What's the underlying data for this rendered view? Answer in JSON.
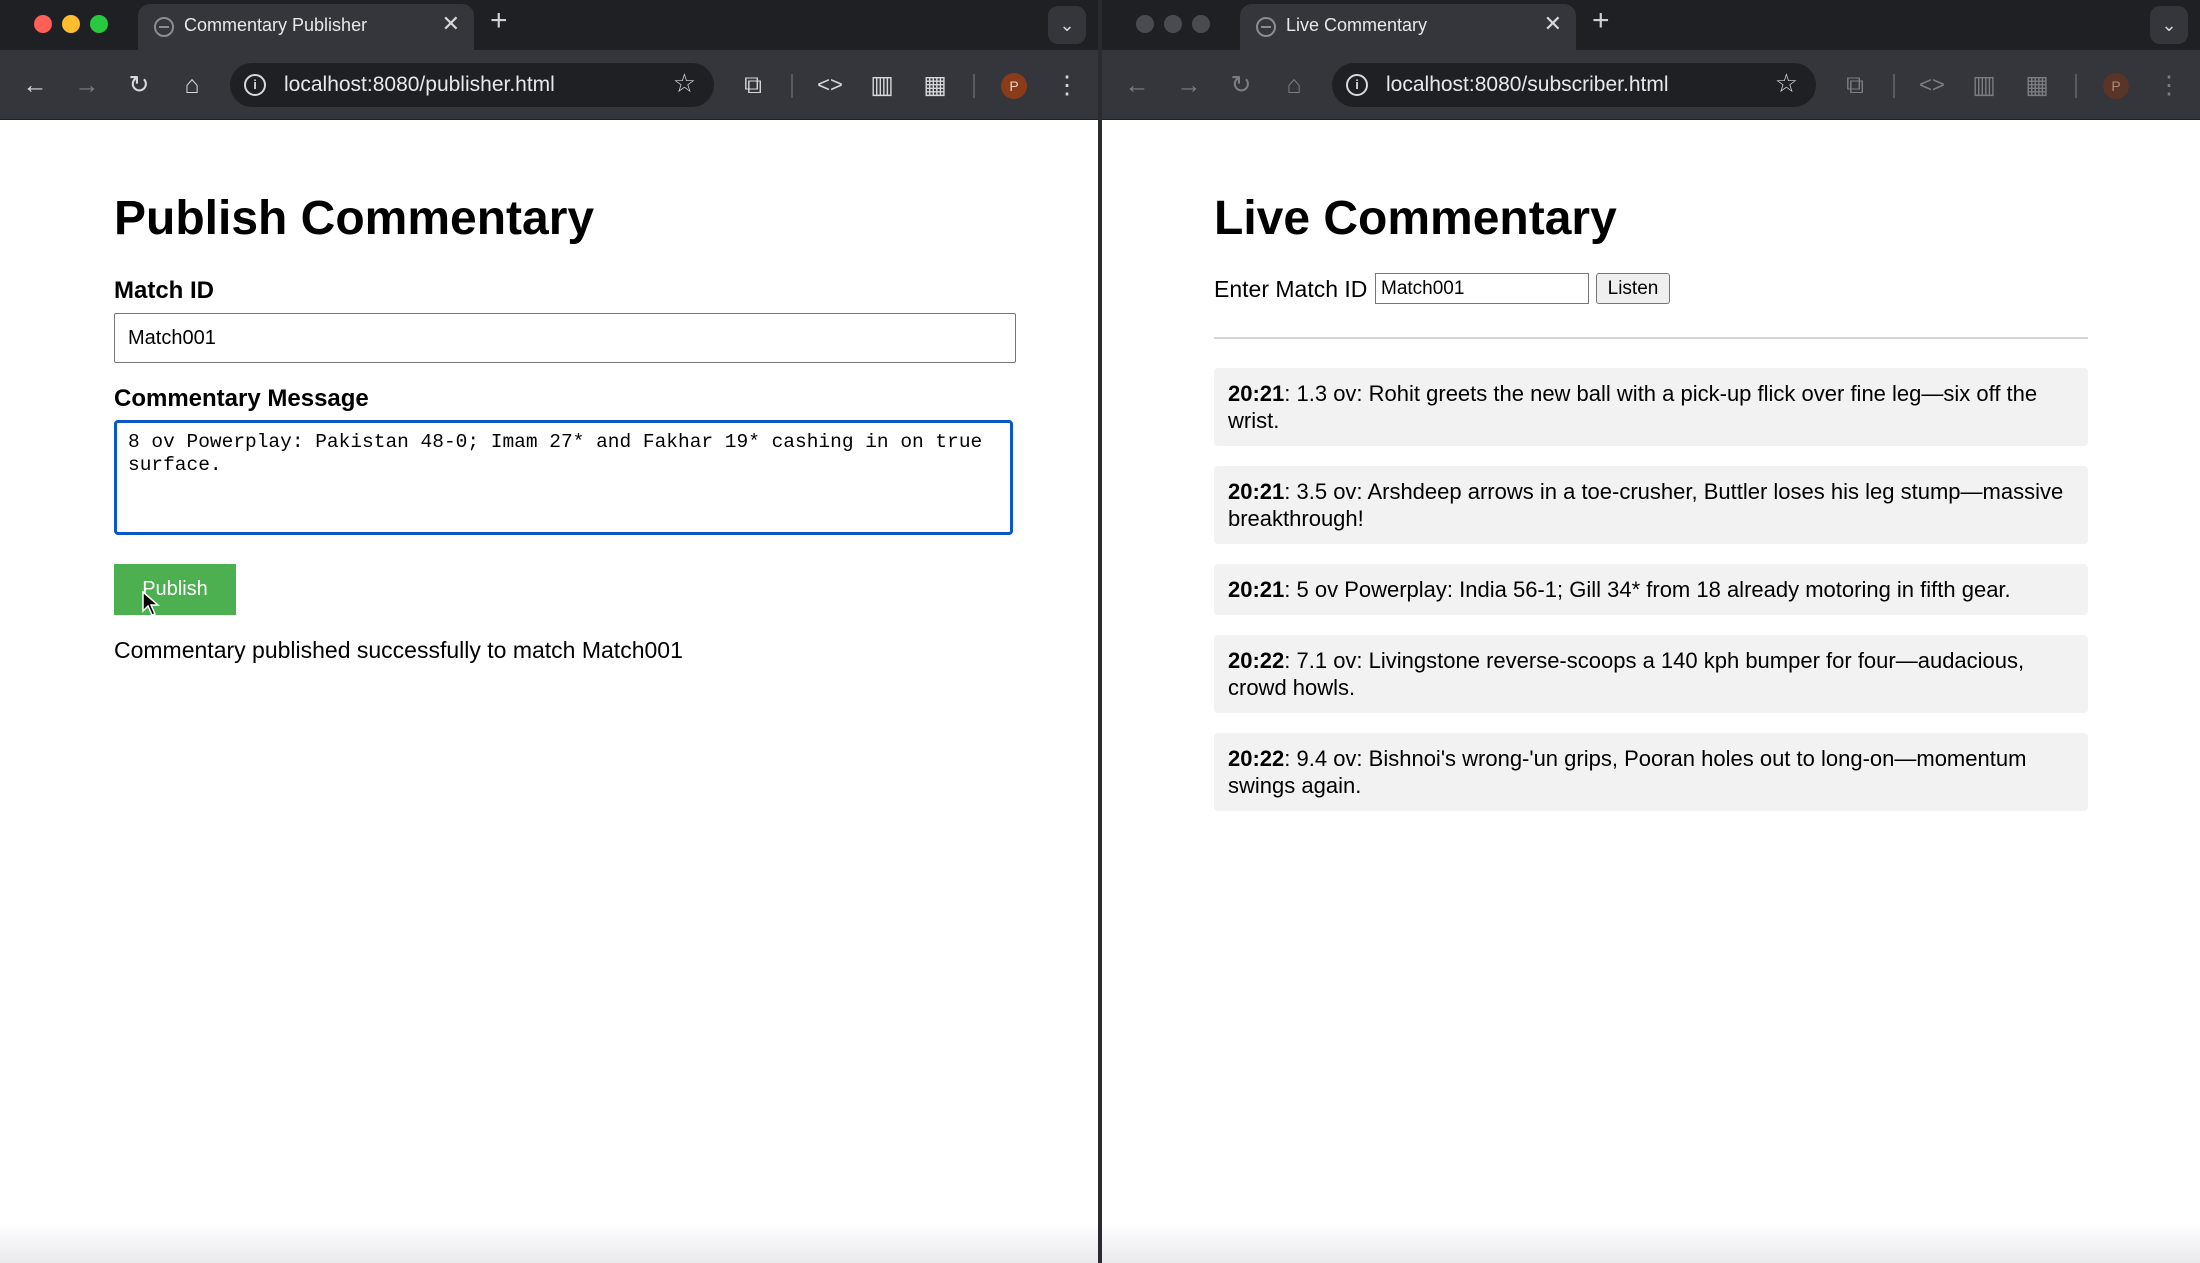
{
  "left_window": {
    "tab_title": "Commentary Publisher",
    "url": "localhost:8080/publisher.html",
    "profile_initial": "P",
    "page": {
      "heading": "Publish Commentary",
      "match_id_label": "Match ID",
      "match_id_value": "Match001",
      "message_label": "Commentary Message",
      "message_value": "8 ov Powerplay: Pakistan 48-0; Imam 27* and Fakhar 19* cashing in on true surface.",
      "publish_label": "Publish",
      "status_text": "Commentary published successfully to match Match001"
    }
  },
  "right_window": {
    "tab_title": "Live Commentary",
    "url": "localhost:8080/subscriber.html",
    "profile_initial": "P",
    "page": {
      "heading": "Live Commentary",
      "enter_label": "Enter Match ID",
      "match_id_value": "Match001",
      "listen_label": "Listen",
      "feed": [
        {
          "time": "20:21",
          "text": ": 1.3 ov: Rohit greets the new ball with a pick-up flick over fine leg—six off the wrist."
        },
        {
          "time": "20:21",
          "text": ": 3.5 ov: Arshdeep arrows in a toe-crusher, Buttler loses his leg stump—massive breakthrough!"
        },
        {
          "time": "20:21",
          "text": ": 5 ov Powerplay: India 56-1; Gill 34* from 18 already motoring in fifth gear."
        },
        {
          "time": "20:22",
          "text": ": 7.1 ov: Livingstone reverse-scoops a 140 kph bumper for four—audacious, crowd howls."
        },
        {
          "time": "20:22",
          "text": ": 9.4 ov: Bishnoi's wrong-'un grips, Pooran holes out to long-on—momentum swings again."
        }
      ]
    }
  },
  "colors": {
    "publish_button": "#4caf50",
    "focus_outline": "#0b58c4",
    "feed_background": "#f2f2f2"
  }
}
